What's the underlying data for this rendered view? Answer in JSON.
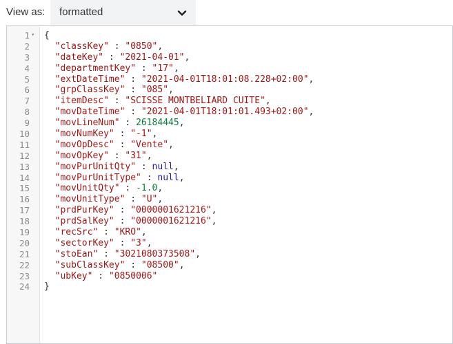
{
  "toolbar": {
    "view_label": "View as:",
    "view_value": "formatted"
  },
  "json_lines": [
    {
      "num": "1",
      "fold": true,
      "parts": [
        {
          "t": "{",
          "c": "p"
        }
      ]
    },
    {
      "num": "2",
      "parts": [
        {
          "t": "  \"classKey\"",
          "c": "k"
        },
        {
          "t": " : ",
          "c": "p"
        },
        {
          "t": "\"0850\"",
          "c": "s"
        },
        {
          "t": ",",
          "c": "p"
        }
      ]
    },
    {
      "num": "3",
      "parts": [
        {
          "t": "  \"dateKey\"",
          "c": "k"
        },
        {
          "t": " : ",
          "c": "p"
        },
        {
          "t": "\"2021-04-01\"",
          "c": "s"
        },
        {
          "t": ",",
          "c": "p"
        }
      ]
    },
    {
      "num": "4",
      "parts": [
        {
          "t": "  \"departmentKey\"",
          "c": "k"
        },
        {
          "t": " : ",
          "c": "p"
        },
        {
          "t": "\"17\"",
          "c": "s"
        },
        {
          "t": ",",
          "c": "p"
        }
      ]
    },
    {
      "num": "5",
      "parts": [
        {
          "t": "  \"extDateTime\"",
          "c": "k"
        },
        {
          "t": " : ",
          "c": "p"
        },
        {
          "t": "\"2021-04-01T18:01:08.228+02:00\"",
          "c": "s"
        },
        {
          "t": ",",
          "c": "p"
        }
      ]
    },
    {
      "num": "6",
      "parts": [
        {
          "t": "  \"grpClassKey\"",
          "c": "k"
        },
        {
          "t": " : ",
          "c": "p"
        },
        {
          "t": "\"085\"",
          "c": "s"
        },
        {
          "t": ",",
          "c": "p"
        }
      ]
    },
    {
      "num": "7",
      "parts": [
        {
          "t": "  \"itemDesc\"",
          "c": "k"
        },
        {
          "t": " : ",
          "c": "p"
        },
        {
          "t": "\"SCISSE MONTBELIARD CUITE\"",
          "c": "s"
        },
        {
          "t": ",",
          "c": "p"
        }
      ]
    },
    {
      "num": "8",
      "parts": [
        {
          "t": "  \"movDateTime\"",
          "c": "k"
        },
        {
          "t": " : ",
          "c": "p"
        },
        {
          "t": "\"2021-04-01T18:01:01.493+02:00\"",
          "c": "s"
        },
        {
          "t": ",",
          "c": "p"
        }
      ]
    },
    {
      "num": "9",
      "parts": [
        {
          "t": "  \"movLineNum\"",
          "c": "k"
        },
        {
          "t": " : ",
          "c": "p"
        },
        {
          "t": "26184445",
          "c": "n"
        },
        {
          "t": ",",
          "c": "p"
        }
      ]
    },
    {
      "num": "10",
      "parts": [
        {
          "t": "  \"movNumKey\"",
          "c": "k"
        },
        {
          "t": " : ",
          "c": "p"
        },
        {
          "t": "\"-1\"",
          "c": "s"
        },
        {
          "t": ",",
          "c": "p"
        }
      ]
    },
    {
      "num": "11",
      "parts": [
        {
          "t": "  \"movOpDesc\"",
          "c": "k"
        },
        {
          "t": " : ",
          "c": "p"
        },
        {
          "t": "\"Vente\"",
          "c": "s"
        },
        {
          "t": ",",
          "c": "p"
        }
      ]
    },
    {
      "num": "12",
      "parts": [
        {
          "t": "  \"movOpKey\"",
          "c": "k"
        },
        {
          "t": " : ",
          "c": "p"
        },
        {
          "t": "\"31\"",
          "c": "s"
        },
        {
          "t": ",",
          "c": "p"
        }
      ]
    },
    {
      "num": "13",
      "parts": [
        {
          "t": "  \"movPurUnitQty\"",
          "c": "k"
        },
        {
          "t": " : ",
          "c": "p"
        },
        {
          "t": "null",
          "c": "l"
        },
        {
          "t": ",",
          "c": "p"
        }
      ]
    },
    {
      "num": "14",
      "parts": [
        {
          "t": "  \"movPurUnitType\"",
          "c": "k"
        },
        {
          "t": " : ",
          "c": "p"
        },
        {
          "t": "null",
          "c": "l"
        },
        {
          "t": ",",
          "c": "p"
        }
      ]
    },
    {
      "num": "15",
      "parts": [
        {
          "t": "  \"movUnitQty\"",
          "c": "k"
        },
        {
          "t": " : ",
          "c": "p"
        },
        {
          "t": "-1.0",
          "c": "n"
        },
        {
          "t": ",",
          "c": "p"
        }
      ]
    },
    {
      "num": "16",
      "parts": [
        {
          "t": "  \"movUnitType\"",
          "c": "k"
        },
        {
          "t": " : ",
          "c": "p"
        },
        {
          "t": "\"U\"",
          "c": "s"
        },
        {
          "t": ",",
          "c": "p"
        }
      ]
    },
    {
      "num": "17",
      "parts": [
        {
          "t": "  \"prdPurKey\"",
          "c": "k"
        },
        {
          "t": " : ",
          "c": "p"
        },
        {
          "t": "\"0000001621216\"",
          "c": "s"
        },
        {
          "t": ",",
          "c": "p"
        }
      ]
    },
    {
      "num": "18",
      "parts": [
        {
          "t": "  \"prdSalKey\"",
          "c": "k"
        },
        {
          "t": " : ",
          "c": "p"
        },
        {
          "t": "\"0000001621216\"",
          "c": "s"
        },
        {
          "t": ",",
          "c": "p"
        }
      ]
    },
    {
      "num": "19",
      "parts": [
        {
          "t": "  \"recSrc\"",
          "c": "k"
        },
        {
          "t": " : ",
          "c": "p"
        },
        {
          "t": "\"KRO\"",
          "c": "s"
        },
        {
          "t": ",",
          "c": "p"
        }
      ]
    },
    {
      "num": "20",
      "parts": [
        {
          "t": "  \"sectorKey\"",
          "c": "k"
        },
        {
          "t": " : ",
          "c": "p"
        },
        {
          "t": "\"3\"",
          "c": "s"
        },
        {
          "t": ",",
          "c": "p"
        }
      ]
    },
    {
      "num": "21",
      "parts": [
        {
          "t": "  \"stoEan\"",
          "c": "k"
        },
        {
          "t": " : ",
          "c": "p"
        },
        {
          "t": "\"3021080373508\"",
          "c": "s"
        },
        {
          "t": ",",
          "c": "p"
        }
      ]
    },
    {
      "num": "22",
      "parts": [
        {
          "t": "  \"subClassKey\"",
          "c": "k"
        },
        {
          "t": " : ",
          "c": "p"
        },
        {
          "t": "\"08500\"",
          "c": "s"
        },
        {
          "t": ",",
          "c": "p"
        }
      ]
    },
    {
      "num": "23",
      "parts": [
        {
          "t": "  \"ubKey\"",
          "c": "k"
        },
        {
          "t": " : ",
          "c": "p"
        },
        {
          "t": "\"0850006\"",
          "c": "s"
        }
      ]
    },
    {
      "num": "24",
      "parts": [
        {
          "t": "}",
          "c": "p"
        }
      ]
    }
  ],
  "colors": {
    "key": "#a31515",
    "string": "#a31515",
    "number": "#0b7b3e",
    "literal": "#1a1aa6",
    "select_bg": "#f1f3f5"
  },
  "icons": {
    "select_chevron": "chevron-down-icon",
    "fold": "fold-arrow-icon"
  }
}
